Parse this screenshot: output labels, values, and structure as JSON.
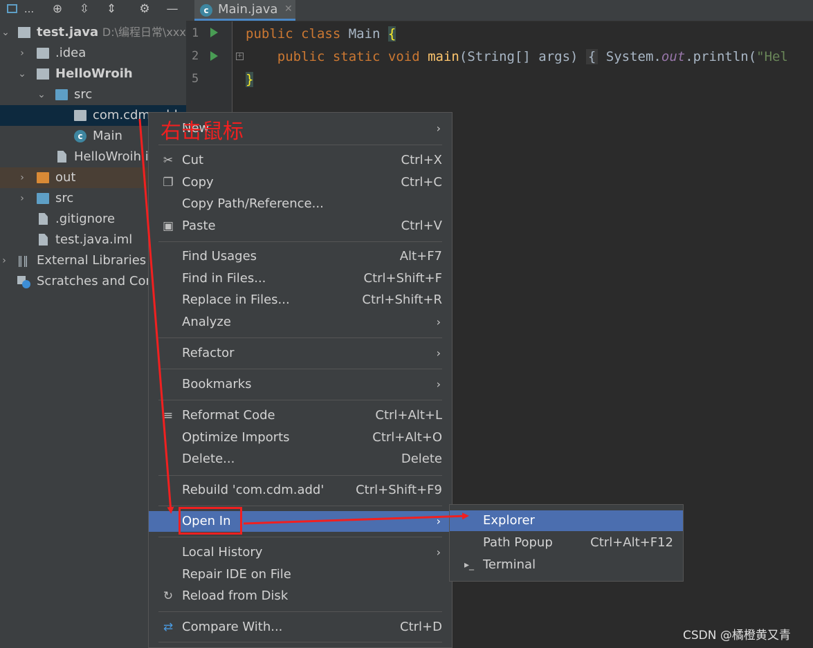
{
  "project_panel": {
    "toolbar_icons": [
      "window-icon",
      "more-icon",
      "locate-icon",
      "expand-all-icon",
      "collapse-all-icon",
      "gear-icon",
      "minimize-icon"
    ],
    "toolbar_more": "...",
    "tree": [
      {
        "label": "test.java",
        "hint": "D:\\编程日常\\xxx\\",
        "bold": true
      },
      {
        "label": ".idea"
      },
      {
        "label": "HelloWroih",
        "bold": true
      },
      {
        "label": "src"
      },
      {
        "label": "com.cdm.add"
      },
      {
        "label": "Main"
      },
      {
        "label": "HelloWroih.iml"
      },
      {
        "label": "out"
      },
      {
        "label": "src"
      },
      {
        "label": ".gitignore"
      },
      {
        "label": "test.java.iml"
      },
      {
        "label": "External Libraries"
      },
      {
        "label": "Scratches and Consoles"
      }
    ]
  },
  "editor": {
    "tab_title": "Main.java",
    "tab_close": "✕",
    "line_numbers": [
      "1",
      "2",
      "5"
    ],
    "code": {
      "l1_kw": "public class ",
      "l1_name": "Main ",
      "l1_brace": "{",
      "l2_indent": "    ",
      "l2_kw": "public static void ",
      "l2_fn": "main",
      "l2_args": "(String[] args) ",
      "l2_fold": "{",
      "l2_sys": " System.",
      "l2_field": "out",
      "l2_call": ".println(",
      "l2_str": "\"Hel",
      "l3_brace": "}"
    }
  },
  "context_menu": {
    "items": [
      {
        "label": "New",
        "submenu": "›"
      },
      {
        "label": "Cut",
        "shortcut": "Ctrl+X"
      },
      {
        "label": "Copy",
        "shortcut": "Ctrl+C"
      },
      {
        "label": "Copy Path/Reference..."
      },
      {
        "label": "Paste",
        "shortcut": "Ctrl+V"
      },
      {
        "label": "Find Usages",
        "shortcut": "Alt+F7"
      },
      {
        "label": "Find in Files...",
        "shortcut": "Ctrl+Shift+F"
      },
      {
        "label": "Replace in Files...",
        "shortcut": "Ctrl+Shift+R"
      },
      {
        "label": "Analyze",
        "submenu": "›"
      },
      {
        "label": "Refactor",
        "submenu": "›"
      },
      {
        "label": "Bookmarks",
        "submenu": "›"
      },
      {
        "label": "Reformat Code",
        "shortcut": "Ctrl+Alt+L"
      },
      {
        "label": "Optimize Imports",
        "shortcut": "Ctrl+Alt+O"
      },
      {
        "label": "Delete...",
        "shortcut": "Delete"
      },
      {
        "label": "Rebuild 'com.cdm.add'",
        "shortcut": "Ctrl+Shift+F9"
      },
      {
        "label": "Open In",
        "submenu": "›"
      },
      {
        "label": "Local History",
        "submenu": "›"
      },
      {
        "label": "Repair IDE on File"
      },
      {
        "label": "Reload from Disk"
      },
      {
        "label": "Compare With...",
        "shortcut": "Ctrl+D"
      }
    ]
  },
  "open_in_submenu": {
    "items": [
      {
        "label": "Explorer"
      },
      {
        "label": "Path Popup",
        "shortcut": "Ctrl+Alt+F12"
      },
      {
        "label": "Terminal"
      }
    ]
  },
  "annotation": {
    "text": "右击鼠标",
    "color": "#f02020"
  },
  "watermark": "CSDN @橘橙黄又青",
  "colors": {
    "selection": "#4b6eaf",
    "panel_bg": "#3c3f41",
    "editor_bg": "#2b2b2b"
  }
}
